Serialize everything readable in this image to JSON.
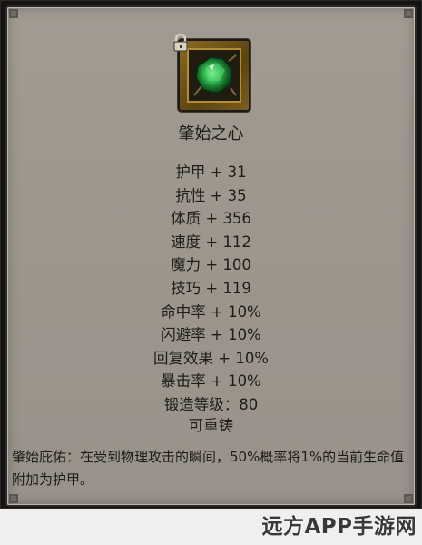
{
  "item": {
    "name": "肇始之心",
    "icon": "green-gem-icon",
    "locked_icon": "lock-icon"
  },
  "stats": [
    "护甲 + 31",
    "抗性 + 35",
    "体质 + 356",
    "速度 + 112",
    "魔力 + 100",
    "技巧 + 119",
    "命中率 + 10%",
    "闪避率 + 10%",
    "回复效果 + 10%",
    "暴击率 + 10%",
    "锻造等级：80"
  ],
  "reforge": "可重铸",
  "effect_text": "肇始庇佑：在受到物理攻击的瞬间，50%概率将1%的当前生命值附加为护甲。",
  "watermark": "远方APP手游网",
  "colors": {
    "panel_bg": "#9c968d",
    "text": "#1f1d1a",
    "frame_gold": "#b58e32",
    "gem_green": "#2e9a3c"
  }
}
